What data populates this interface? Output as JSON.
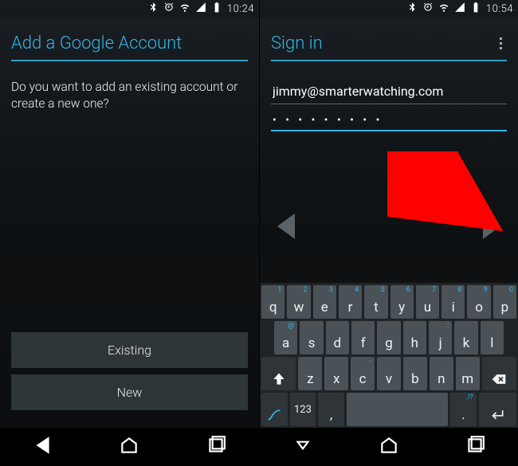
{
  "left": {
    "status": {
      "time": "10:24"
    },
    "title": "Add a Google Account",
    "prompt": "Do you want to add an existing account or create a new one?",
    "buttons": {
      "existing": "Existing",
      "new": "New"
    }
  },
  "right": {
    "status": {
      "time": "10:54"
    },
    "title": "Sign in",
    "email_value": "jimmy@smarterwatching.com",
    "password_mask": "• • • • • • • • •"
  },
  "keyboard": {
    "row1": [
      {
        "k": "q",
        "s": "1"
      },
      {
        "k": "w",
        "s": "2"
      },
      {
        "k": "e",
        "s": "3"
      },
      {
        "k": "r",
        "s": "4"
      },
      {
        "k": "t",
        "s": "5"
      },
      {
        "k": "y",
        "s": "6"
      },
      {
        "k": "u",
        "s": "7"
      },
      {
        "k": "i",
        "s": "8"
      },
      {
        "k": "o",
        "s": "9"
      },
      {
        "k": "p",
        "s": "0"
      }
    ],
    "row2": [
      {
        "k": "a",
        "s": "@"
      },
      {
        "k": "s",
        "s": ""
      },
      {
        "k": "d",
        "s": ""
      },
      {
        "k": "f",
        "s": ""
      },
      {
        "k": "g",
        "s": ""
      },
      {
        "k": "h",
        "s": ""
      },
      {
        "k": "j",
        "s": ":"
      },
      {
        "k": "k",
        "s": ""
      },
      {
        "k": "l",
        "s": ""
      }
    ],
    "row3": [
      {
        "k": "z",
        "s": ""
      },
      {
        "k": "x",
        "s": ""
      },
      {
        "k": "c",
        "s": "-"
      },
      {
        "k": "v",
        "s": ""
      },
      {
        "k": "b",
        "s": ""
      },
      {
        "k": "n",
        "s": ""
      },
      {
        "k": "m",
        "s": ""
      }
    ],
    "sym_label": "123",
    "comma": ",",
    "period": ".",
    "punct_sup": ".!?"
  }
}
